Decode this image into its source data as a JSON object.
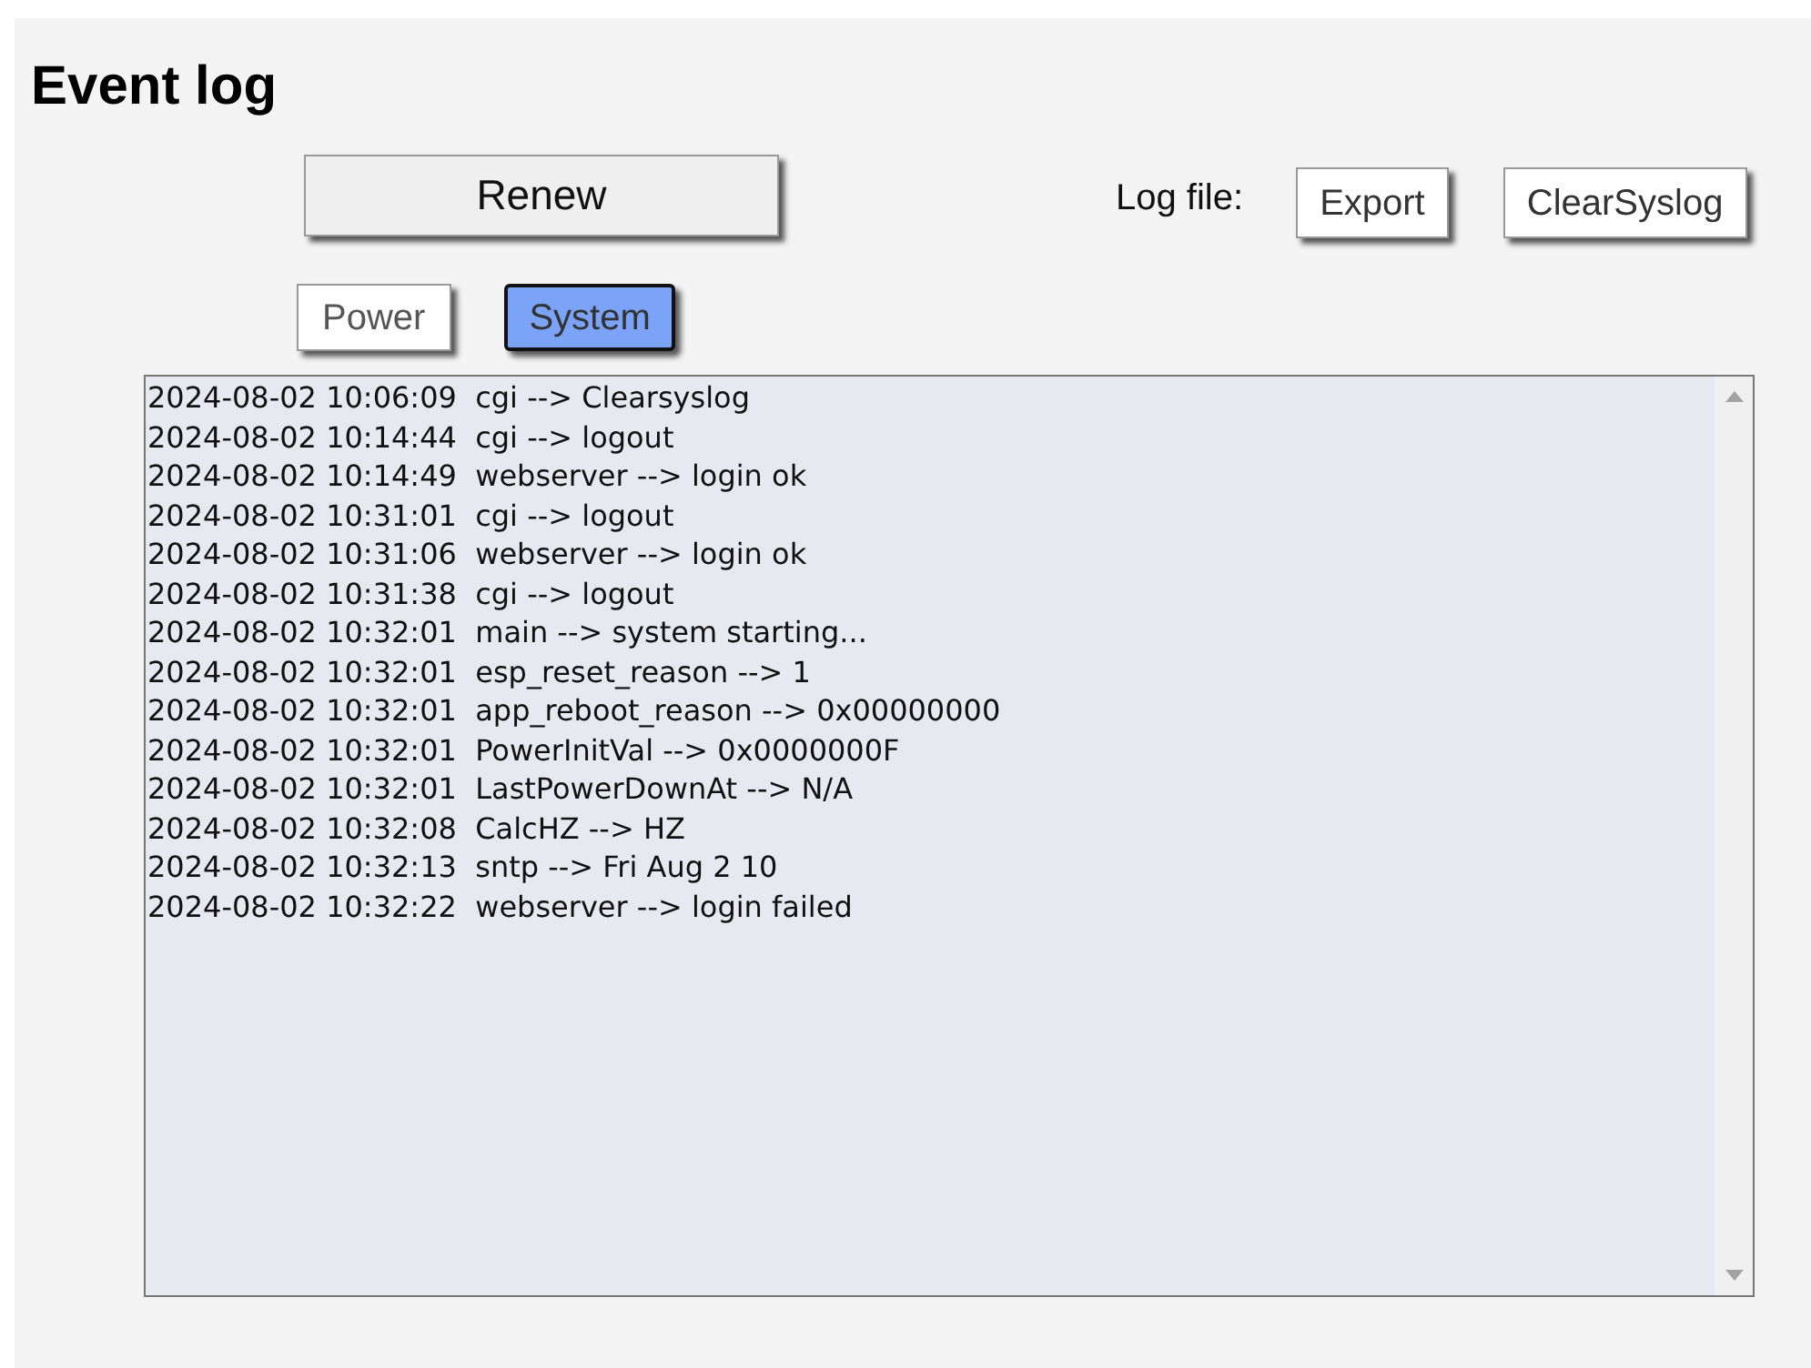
{
  "title": "Event log",
  "renew_button": "Renew",
  "log_file": {
    "label": "Log file:",
    "buttons": [
      "Export",
      "ClearSyslog"
    ]
  },
  "tabs": [
    {
      "label": "Power",
      "selected": false
    },
    {
      "label": "System",
      "selected": true
    }
  ],
  "log_lines": [
    "2024-08-02 10:06:09  cgi --> Clearsyslog",
    "2024-08-02 10:14:44  cgi --> logout",
    "2024-08-02 10:14:49  webserver --> login ok",
    "2024-08-02 10:31:01  cgi --> logout",
    "2024-08-02 10:31:06  webserver --> login ok",
    "2024-08-02 10:31:38  cgi --> logout",
    "2024-08-02 10:32:01  main --> system starting...",
    "2024-08-02 10:32:01  esp_reset_reason --> 1",
    "2024-08-02 10:32:01  app_reboot_reason --> 0x00000000",
    "2024-08-02 10:32:01  PowerInitVal --> 0x0000000F",
    "2024-08-02 10:32:01  LastPowerDownAt --> N/A",
    "2024-08-02 10:32:08  CalcHZ --> HZ",
    "2024-08-02 10:32:13  sntp --> Fri Aug 2 10",
    "2024-08-02 10:32:22  webserver --> login failed"
  ]
}
